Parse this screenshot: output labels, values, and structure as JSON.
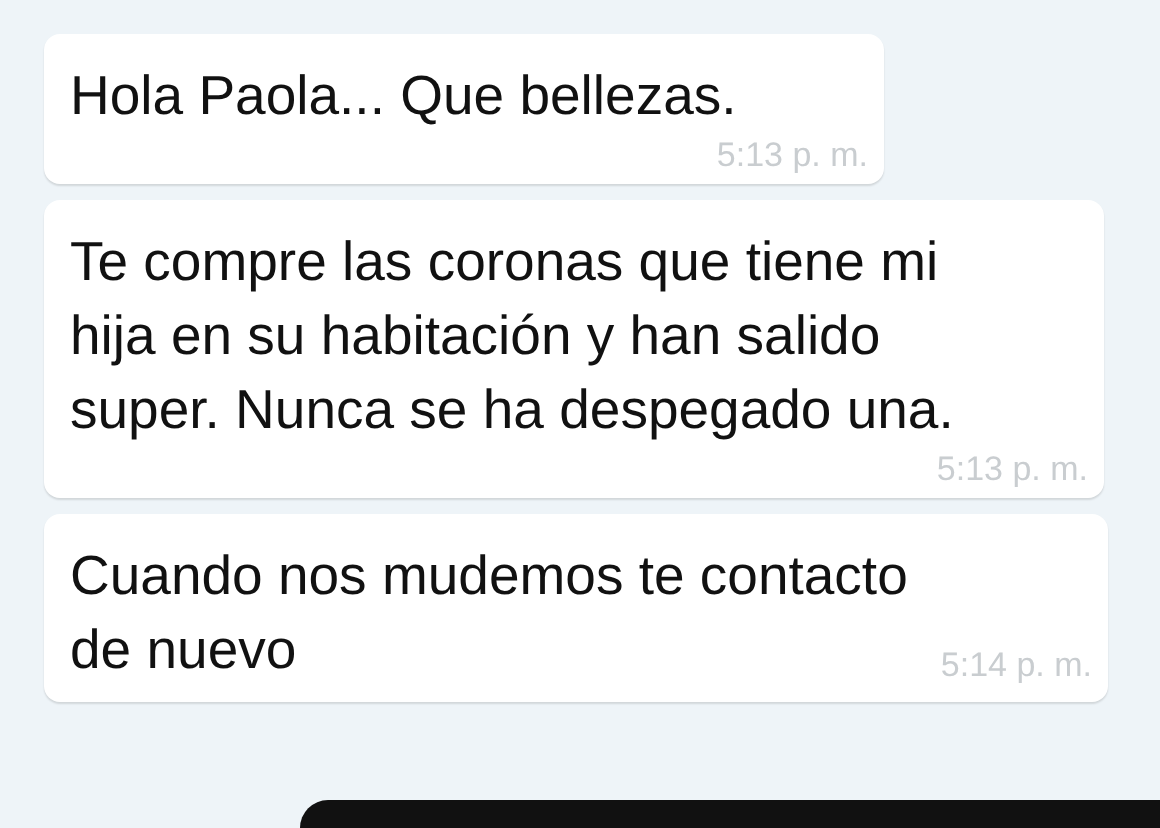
{
  "messages": [
    {
      "text": "Hola Paola... Que bellezas.",
      "time": "5:13 p. m."
    },
    {
      "text": "Te compre las coronas que tiene mi hija en su habitación y han salido super. Nunca se ha despegado una.",
      "time": "5:13 p. m."
    },
    {
      "text": "Cuando nos mudemos te contacto de nuevo",
      "time": "5:14 p. m."
    }
  ]
}
